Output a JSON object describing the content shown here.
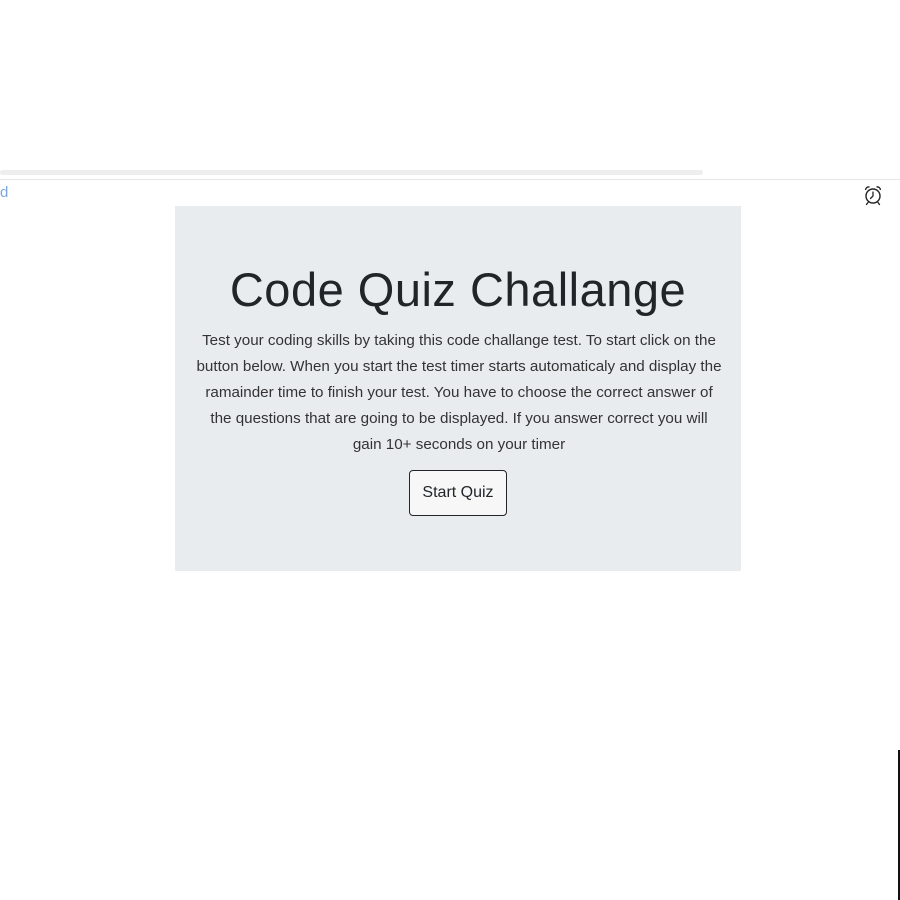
{
  "header": {
    "partial_link_text": "d",
    "timer_icon": "alarm-clock-icon"
  },
  "main": {
    "title": "Code Quiz Challange",
    "description": "Test your coding skills by taking this code challange test. To start click on the button below. When you start the test timer starts automaticaly and display the ramainder time to finish your test. You have to choose the correct answer of the questions that are going to be displayed. If you answer correct you will gain 10+ seconds on your timer",
    "start_button_label": "Start Quiz"
  },
  "colors": {
    "jumbotron_bg": "#e9ecef",
    "link": "#7aa7e0",
    "text": "#212529"
  }
}
